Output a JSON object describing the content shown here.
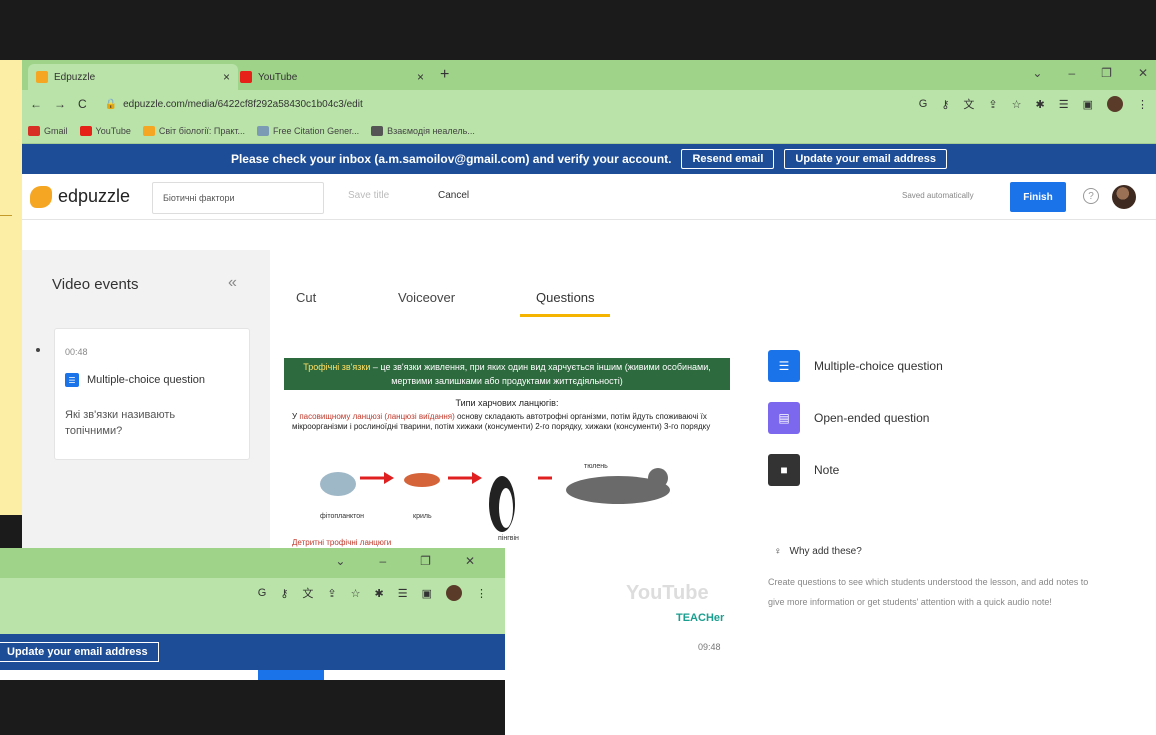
{
  "browser": {
    "tabs": [
      {
        "title": "Edpuzzle",
        "favicon_color": "#f5a623",
        "active": true
      },
      {
        "title": "YouTube",
        "favicon_color": "#e62117",
        "active": false
      }
    ],
    "url": "edpuzzle.com/media/6422cf8f292a58430c1b04c3/edit",
    "bookmarks": [
      {
        "label": "Gmail",
        "color": "#d93025"
      },
      {
        "label": "YouTube",
        "color": "#e62117"
      },
      {
        "label": "Світ біології: Практ...",
        "color": "#f5a623"
      },
      {
        "label": "Free Citation Gener...",
        "color": "#7b9bb5"
      },
      {
        "label": "Взаємодія неалель...",
        "color": "#555555"
      }
    ]
  },
  "verify_banner": {
    "text": "Please check your inbox (a.m.samoilov@gmail.com) and verify your account.",
    "resend": "Resend email",
    "update": "Update your email address"
  },
  "header": {
    "logo": "edpuzzle",
    "title_value": "Біотичні фактори",
    "save_title": "Save title",
    "cancel": "Cancel",
    "saved_status": "Saved automatically",
    "finish": "Finish",
    "help": "?"
  },
  "sidebar": {
    "title": "Video events",
    "collapse": "«",
    "event": {
      "time": "00:48",
      "type": "Multiple-choice question",
      "question": "Які зв'язки називають топічними?"
    }
  },
  "editor_tabs": [
    "Cut",
    "Voiceover",
    "Questions"
  ],
  "active_tab": "Questions",
  "video": {
    "slide_heading_highlight": "Трофічні зв'язки",
    "slide_heading_rest": " – це зв'язки живлення, при яких один вид харчується іншим (живими особинами, мертвими залишками або продуктами життєдіяльності)",
    "slide_subtitle": "Типи харчових ланцюгів:",
    "slide_text_intro": "У ",
    "slide_text_red": "пасовищному ланцюзі (ланцюзі виїдання)",
    "slide_text_rest": " основу складають автотрофні організми, потім йдуть споживаючі їх мікроорганізми і рослиноїдні тварини, потім хижаки (консументи) 2-го порядку, хижаки (консументи) 3-го порядку",
    "chain_labels": [
      "фітопланктон",
      "криль",
      "пінгвін",
      "тюлень"
    ],
    "detritus": "Детритні трофічні ланцюги",
    "yt_logo": "YouTube",
    "teacher": "TEACHer",
    "time": "09:48"
  },
  "question_types": [
    {
      "label": "Multiple-choice question",
      "color": "#1a73e8",
      "icon": "list-icon",
      "glyph": "☰"
    },
    {
      "label": "Open-ended question",
      "color": "#7b68ee",
      "icon": "comment-icon",
      "glyph": "▤"
    },
    {
      "label": "Note",
      "color": "#333333",
      "icon": "note-icon",
      "glyph": "■"
    }
  ],
  "why": {
    "title": "Why add these?",
    "text": "Create questions to see which students understood the lesson, and add notes to give more information or get students' attention with a quick audio note!"
  },
  "overlay_window": {
    "update": "Update your email address"
  }
}
